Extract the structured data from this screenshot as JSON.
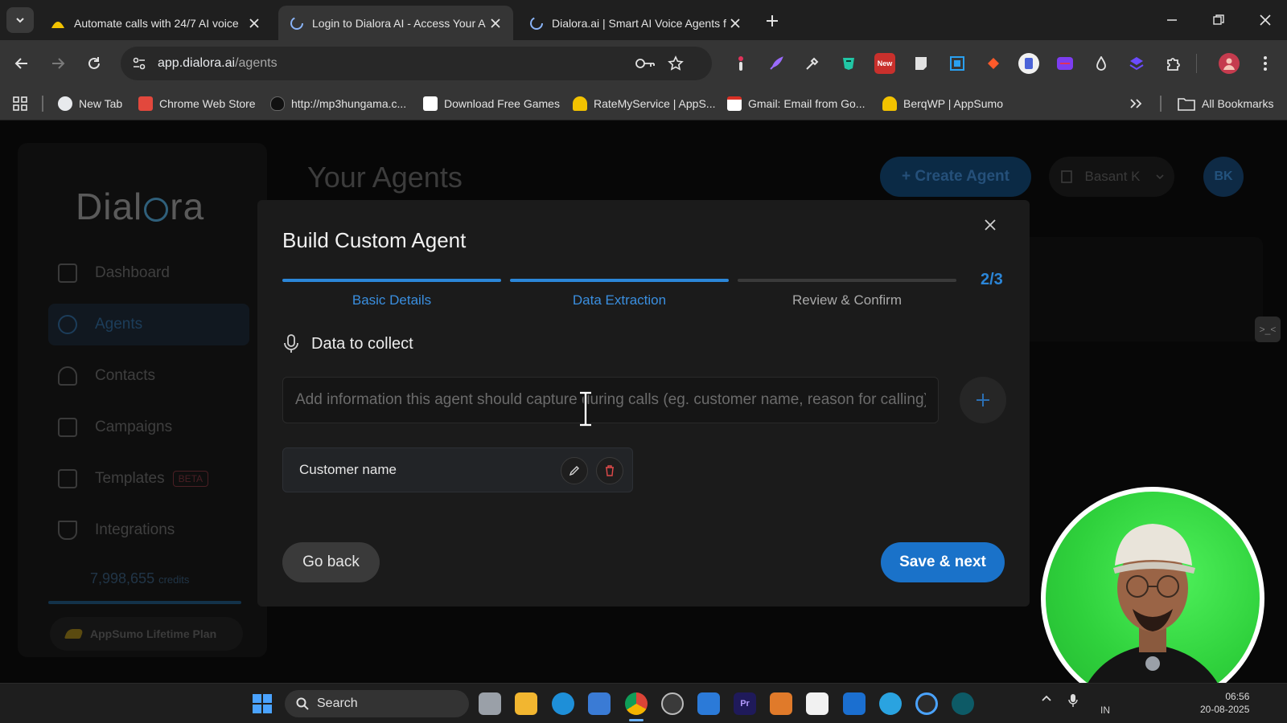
{
  "browser": {
    "tabs": [
      {
        "title": "Automate calls with 24/7 AI voice",
        "active": false
      },
      {
        "title": "Login to Dialora AI - Access Your A",
        "active": true
      },
      {
        "title": "Dialora.ai | Smart AI Voice Agents f",
        "active": false
      }
    ],
    "url_host": "app.dialora.ai",
    "url_path": "/agents",
    "extensions": [
      {
        "icon": "tag-icon",
        "color": "#e2e2e2"
      },
      {
        "icon": "feather-icon",
        "color": "#9b6bff"
      },
      {
        "icon": "eyedropper-icon",
        "color": "#e2e2e2"
      },
      {
        "icon": "bookmark-shield-icon",
        "color": "#21c6a5"
      },
      {
        "icon": "new-badge-icon",
        "color": "#d33b3b",
        "badge": "New"
      },
      {
        "icon": "note-icon",
        "color": "#e2e2e2"
      },
      {
        "icon": "screen-capture-icon",
        "color": "#2aa0f0"
      },
      {
        "icon": "arrow-ext-icon",
        "color": "#ff5a2a"
      },
      {
        "icon": "g-ext-icon",
        "color": "#ffffff"
      },
      {
        "icon": "purple-ext-icon",
        "color": "#7d3df0"
      },
      {
        "icon": "drop-icon",
        "color": "#e2e2e2"
      },
      {
        "icon": "layers-icon",
        "color": "#6b4bff"
      },
      {
        "icon": "puzzle-icon",
        "color": "#e2e2e2"
      }
    ],
    "bookmarks": [
      {
        "label": "New Tab",
        "color": "#e8eaed"
      },
      {
        "label": "Chrome Web Store",
        "color": "#e2483d"
      },
      {
        "label": "http://mp3hungama.c...",
        "color": "#2a2a2a"
      },
      {
        "label": "Download Free Games",
        "color": "#ffffff"
      },
      {
        "label": "RateMyService | AppS...",
        "color": "#f2c200"
      },
      {
        "label": "Gmail: Email from Go...",
        "color": "#d93025"
      },
      {
        "label": "BerqWP | AppSumo",
        "color": "#f2c200"
      }
    ],
    "all_bookmarks": "All Bookmarks"
  },
  "app": {
    "logo": "Dialora",
    "nav": [
      {
        "label": "Dashboard",
        "active": false
      },
      {
        "label": "Agents",
        "active": true
      },
      {
        "label": "Contacts",
        "active": false
      },
      {
        "label": "Campaigns",
        "active": false
      },
      {
        "label": "Templates",
        "active": false,
        "badge": "BETA"
      },
      {
        "label": "Integrations",
        "active": false
      }
    ],
    "credits_value": "7,998,655",
    "credits_unit": "credits",
    "plan": "AppSumo Lifetime Plan",
    "page_title": "Your Agents",
    "create_label": "+ Create Agent",
    "user_name": "Basant K",
    "avatar_initials": "BK",
    "toggle_glyph": ">_<"
  },
  "modal": {
    "title": "Build Custom Agent",
    "steps": [
      {
        "label": "Basic Details",
        "complete": true
      },
      {
        "label": "Data Extraction",
        "complete": true
      },
      {
        "label": "Review & Confirm",
        "complete": false
      }
    ],
    "step_counter": "2/3",
    "section_title": "Data to collect",
    "input_placeholder": "Add information this agent should capture during calls (eg. customer name, reason for calling)",
    "items": [
      {
        "label": "Customer name"
      }
    ],
    "back_label": "Go back",
    "next_label": "Save & next",
    "accent": "#1a72c9"
  },
  "taskbar": {
    "search_label": "Search",
    "tray_lang": "IN",
    "time": "06:56",
    "date": "20-08-2025"
  }
}
